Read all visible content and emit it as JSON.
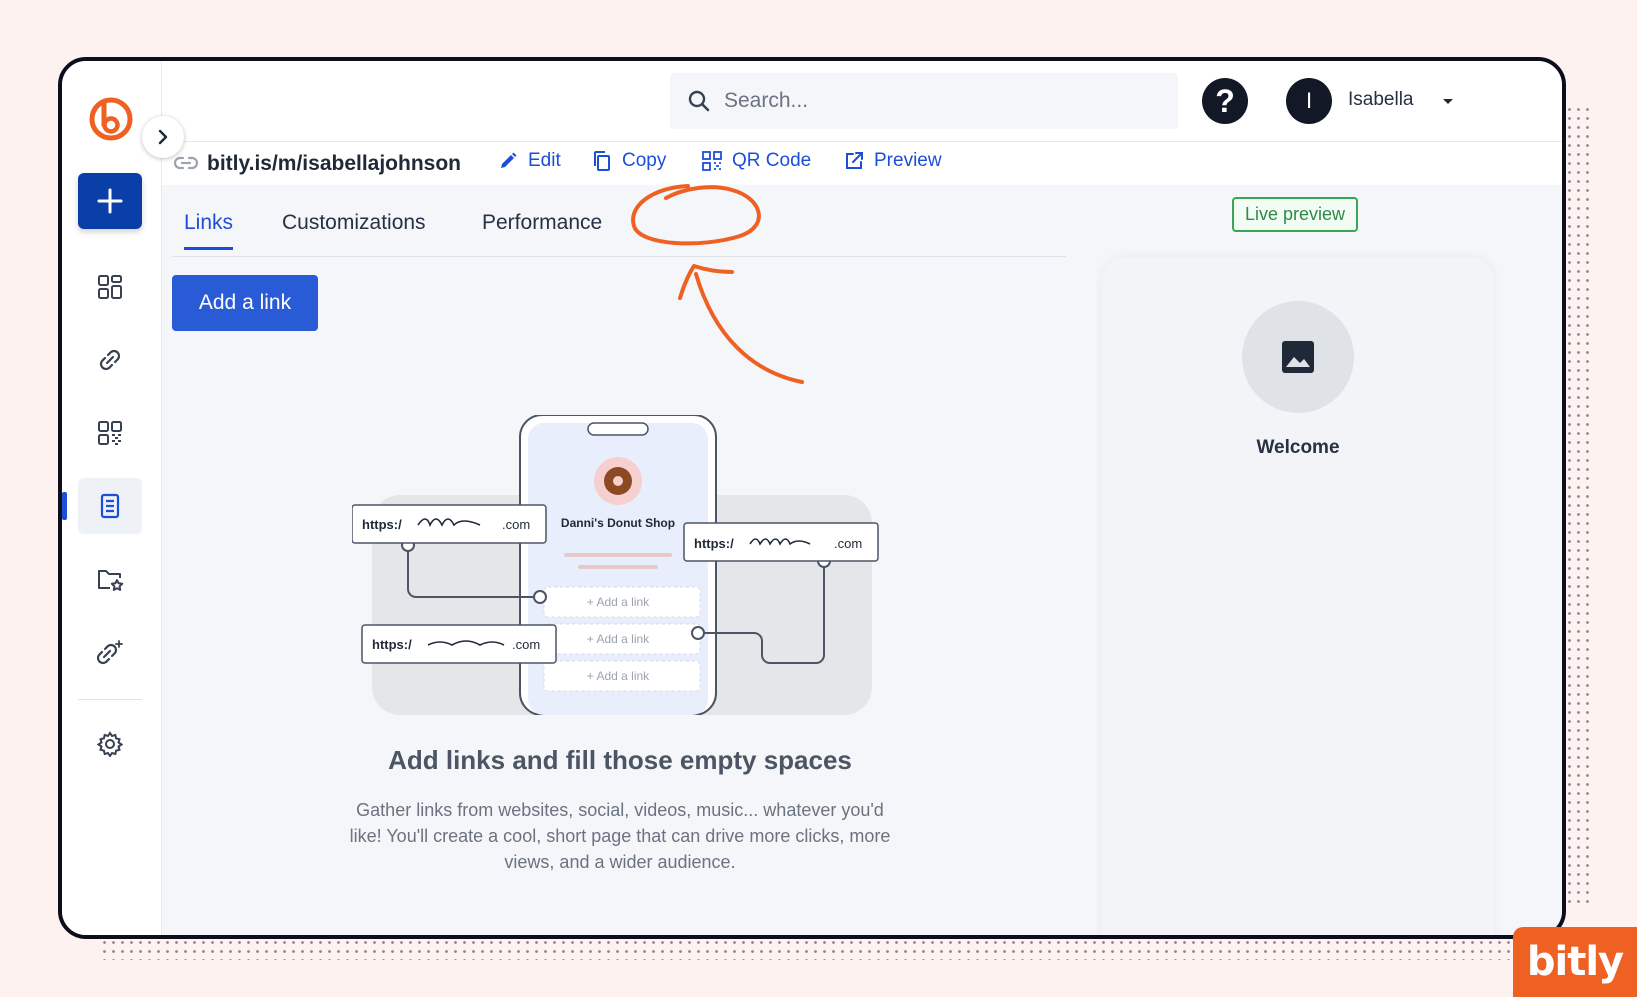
{
  "header": {
    "search_placeholder": "Search...",
    "help_label": "?",
    "user_initial": "I",
    "user_name": "Isabella"
  },
  "linkbar": {
    "page_url": "bitly.is/m/isabellajohnson",
    "edit_label": "Edit",
    "copy_label": "Copy",
    "qr_label": "QR Code",
    "preview_label": "Preview"
  },
  "tabs": [
    {
      "label": "Links",
      "active": true
    },
    {
      "label": "Customizations",
      "active": false
    },
    {
      "label": "Performance",
      "active": false
    }
  ],
  "main": {
    "add_link_label": "Add a link",
    "empty_title": "Add links and fill those empty spaces",
    "empty_description": "Gather links from websites, social, videos, music... whatever you'd like! You'll create a cool, short page that can drive more clicks, more views, and a wider audience."
  },
  "illustration": {
    "shop_name": "Danni's Donut Shop",
    "link_prefix": "https:/",
    "link_suffix": ".com",
    "add_link_row": "+ Add a link"
  },
  "preview": {
    "badge": "Live preview",
    "title": "Welcome"
  },
  "brand": {
    "wordmark": "bitly"
  },
  "colors": {
    "brand_orange": "#ee6123",
    "primary_blue": "#1d4ed8",
    "navy": "#0b3fa8",
    "live_green": "#3aa655"
  }
}
